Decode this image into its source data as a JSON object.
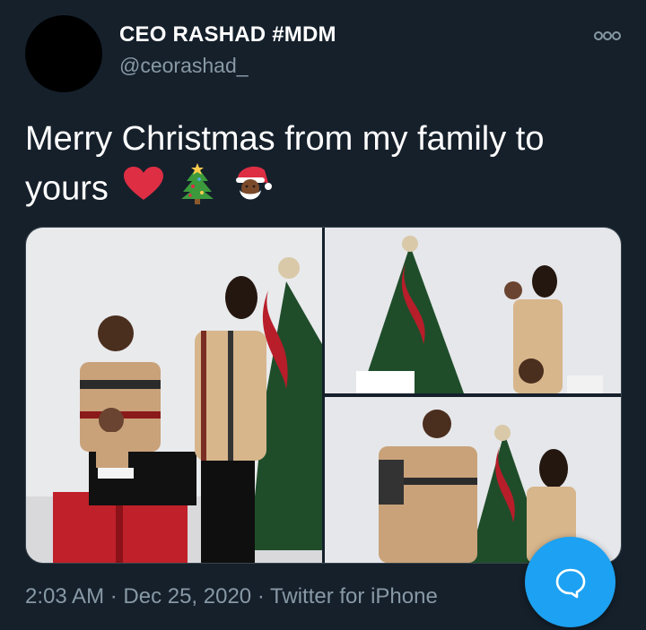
{
  "user": {
    "display_name": "CEO RASHAD #MDM",
    "handle": "@ceorashad_",
    "avatar_icon": "avatar"
  },
  "tweet": {
    "text": "Merry Christmas from my family to yours",
    "emojis": [
      "heart-emoji",
      "christmas-tree-emoji",
      "santa-emoji"
    ]
  },
  "media": {
    "photo_count": 3
  },
  "meta": {
    "timestamp": "2:03 AM · Dec 25, 2020 · Twitter for iPhone"
  },
  "icons": {
    "more": "more-options-icon",
    "compose": "chat-bubble-icon"
  },
  "colors": {
    "background": "#15202b",
    "secondary_text": "#8899a6",
    "accent": "#1da1f2"
  }
}
